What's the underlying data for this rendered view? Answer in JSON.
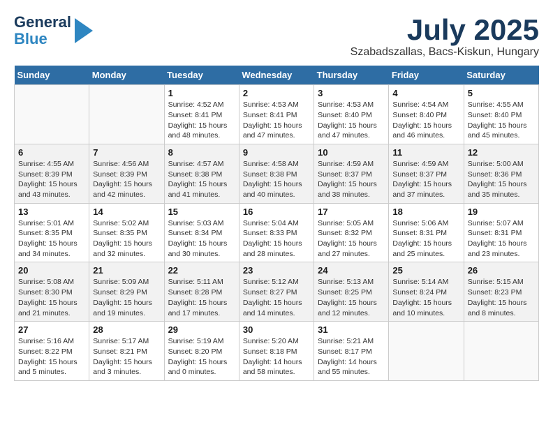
{
  "header": {
    "logo_line1": "General",
    "logo_line2": "Blue",
    "month": "July 2025",
    "location": "Szabadszallas, Bacs-Kiskun, Hungary"
  },
  "weekdays": [
    "Sunday",
    "Monday",
    "Tuesday",
    "Wednesday",
    "Thursday",
    "Friday",
    "Saturday"
  ],
  "weeks": [
    [
      {
        "day": "",
        "info": ""
      },
      {
        "day": "",
        "info": ""
      },
      {
        "day": "1",
        "info": "Sunrise: 4:52 AM\nSunset: 8:41 PM\nDaylight: 15 hours and 48 minutes."
      },
      {
        "day": "2",
        "info": "Sunrise: 4:53 AM\nSunset: 8:41 PM\nDaylight: 15 hours and 47 minutes."
      },
      {
        "day": "3",
        "info": "Sunrise: 4:53 AM\nSunset: 8:40 PM\nDaylight: 15 hours and 47 minutes."
      },
      {
        "day": "4",
        "info": "Sunrise: 4:54 AM\nSunset: 8:40 PM\nDaylight: 15 hours and 46 minutes."
      },
      {
        "day": "5",
        "info": "Sunrise: 4:55 AM\nSunset: 8:40 PM\nDaylight: 15 hours and 45 minutes."
      }
    ],
    [
      {
        "day": "6",
        "info": "Sunrise: 4:55 AM\nSunset: 8:39 PM\nDaylight: 15 hours and 43 minutes."
      },
      {
        "day": "7",
        "info": "Sunrise: 4:56 AM\nSunset: 8:39 PM\nDaylight: 15 hours and 42 minutes."
      },
      {
        "day": "8",
        "info": "Sunrise: 4:57 AM\nSunset: 8:38 PM\nDaylight: 15 hours and 41 minutes."
      },
      {
        "day": "9",
        "info": "Sunrise: 4:58 AM\nSunset: 8:38 PM\nDaylight: 15 hours and 40 minutes."
      },
      {
        "day": "10",
        "info": "Sunrise: 4:59 AM\nSunset: 8:37 PM\nDaylight: 15 hours and 38 minutes."
      },
      {
        "day": "11",
        "info": "Sunrise: 4:59 AM\nSunset: 8:37 PM\nDaylight: 15 hours and 37 minutes."
      },
      {
        "day": "12",
        "info": "Sunrise: 5:00 AM\nSunset: 8:36 PM\nDaylight: 15 hours and 35 minutes."
      }
    ],
    [
      {
        "day": "13",
        "info": "Sunrise: 5:01 AM\nSunset: 8:35 PM\nDaylight: 15 hours and 34 minutes."
      },
      {
        "day": "14",
        "info": "Sunrise: 5:02 AM\nSunset: 8:35 PM\nDaylight: 15 hours and 32 minutes."
      },
      {
        "day": "15",
        "info": "Sunrise: 5:03 AM\nSunset: 8:34 PM\nDaylight: 15 hours and 30 minutes."
      },
      {
        "day": "16",
        "info": "Sunrise: 5:04 AM\nSunset: 8:33 PM\nDaylight: 15 hours and 28 minutes."
      },
      {
        "day": "17",
        "info": "Sunrise: 5:05 AM\nSunset: 8:32 PM\nDaylight: 15 hours and 27 minutes."
      },
      {
        "day": "18",
        "info": "Sunrise: 5:06 AM\nSunset: 8:31 PM\nDaylight: 15 hours and 25 minutes."
      },
      {
        "day": "19",
        "info": "Sunrise: 5:07 AM\nSunset: 8:31 PM\nDaylight: 15 hours and 23 minutes."
      }
    ],
    [
      {
        "day": "20",
        "info": "Sunrise: 5:08 AM\nSunset: 8:30 PM\nDaylight: 15 hours and 21 minutes."
      },
      {
        "day": "21",
        "info": "Sunrise: 5:09 AM\nSunset: 8:29 PM\nDaylight: 15 hours and 19 minutes."
      },
      {
        "day": "22",
        "info": "Sunrise: 5:11 AM\nSunset: 8:28 PM\nDaylight: 15 hours and 17 minutes."
      },
      {
        "day": "23",
        "info": "Sunrise: 5:12 AM\nSunset: 8:27 PM\nDaylight: 15 hours and 14 minutes."
      },
      {
        "day": "24",
        "info": "Sunrise: 5:13 AM\nSunset: 8:25 PM\nDaylight: 15 hours and 12 minutes."
      },
      {
        "day": "25",
        "info": "Sunrise: 5:14 AM\nSunset: 8:24 PM\nDaylight: 15 hours and 10 minutes."
      },
      {
        "day": "26",
        "info": "Sunrise: 5:15 AM\nSunset: 8:23 PM\nDaylight: 15 hours and 8 minutes."
      }
    ],
    [
      {
        "day": "27",
        "info": "Sunrise: 5:16 AM\nSunset: 8:22 PM\nDaylight: 15 hours and 5 minutes."
      },
      {
        "day": "28",
        "info": "Sunrise: 5:17 AM\nSunset: 8:21 PM\nDaylight: 15 hours and 3 minutes."
      },
      {
        "day": "29",
        "info": "Sunrise: 5:19 AM\nSunset: 8:20 PM\nDaylight: 15 hours and 0 minutes."
      },
      {
        "day": "30",
        "info": "Sunrise: 5:20 AM\nSunset: 8:18 PM\nDaylight: 14 hours and 58 minutes."
      },
      {
        "day": "31",
        "info": "Sunrise: 5:21 AM\nSunset: 8:17 PM\nDaylight: 14 hours and 55 minutes."
      },
      {
        "day": "",
        "info": ""
      },
      {
        "day": "",
        "info": ""
      }
    ]
  ]
}
